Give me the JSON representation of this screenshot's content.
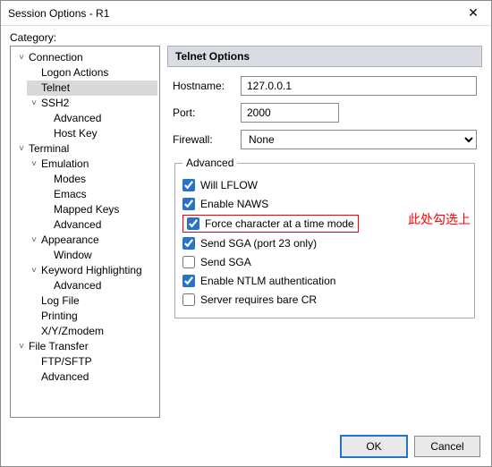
{
  "window": {
    "title": "Session Options - R1"
  },
  "category_label": "Category:",
  "tree": {
    "connection": "Connection",
    "logon_actions": "Logon Actions",
    "telnet": "Telnet",
    "ssh2": "SSH2",
    "ssh2_advanced": "Advanced",
    "ssh2_hostkey": "Host Key",
    "terminal": "Terminal",
    "emulation": "Emulation",
    "em_modes": "Modes",
    "em_emacs": "Emacs",
    "em_mapped": "Mapped Keys",
    "em_advanced": "Advanced",
    "appearance": "Appearance",
    "ap_window": "Window",
    "keyword_hl": "Keyword Highlighting",
    "kh_advanced": "Advanced",
    "logfile": "Log File",
    "printing": "Printing",
    "xyz": "X/Y/Zmodem",
    "file_transfer": "File Transfer",
    "ftpsftp": "FTP/SFTP",
    "ft_advanced": "Advanced"
  },
  "panel": {
    "title": "Telnet Options",
    "hostname_label": "Hostname:",
    "hostname_value": "127.0.0.1",
    "port_label": "Port:",
    "port_value": "2000",
    "firewall_label": "Firewall:",
    "firewall_value": "None",
    "advanced_legend": "Advanced",
    "will_lflow": "Will LFLOW",
    "enable_naws": "Enable NAWS",
    "force_char": "Force character at a time mode",
    "send_sga23": "Send SGA (port 23 only)",
    "send_sga": "Send SGA",
    "enable_ntlm": "Enable NTLM authentication",
    "bare_cr": "Server requires bare CR",
    "checked": {
      "will_lflow": true,
      "enable_naws": true,
      "force_char": true,
      "send_sga23": true,
      "send_sga": false,
      "enable_ntlm": true,
      "bare_cr": false
    },
    "annotation": "此处勾选上"
  },
  "buttons": {
    "ok": "OK",
    "cancel": "Cancel"
  }
}
